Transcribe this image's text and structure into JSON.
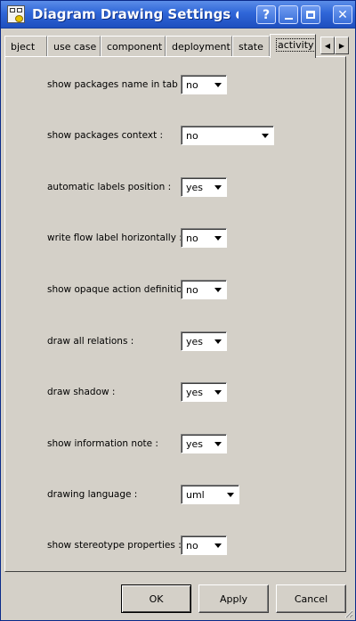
{
  "window": {
    "title": "Diagram Drawing Settings dialog",
    "buttons": {
      "help": "?",
      "close": "✕"
    }
  },
  "tabs": [
    {
      "label": "bject",
      "active": false
    },
    {
      "label": "use case",
      "active": false
    },
    {
      "label": "component",
      "active": false
    },
    {
      "label": "deployment",
      "active": false
    },
    {
      "label": "state",
      "active": false
    },
    {
      "label": "activity",
      "active": true
    }
  ],
  "settings": [
    {
      "label": "show packages name in tab :",
      "value": "no"
    },
    {
      "label": "show packages context :",
      "value": "no"
    },
    {
      "label": "automatic labels position :",
      "value": "yes"
    },
    {
      "label": "write flow label horizontally :",
      "value": "no"
    },
    {
      "label": "show opaque action definition :",
      "value": "no"
    },
    {
      "label": "draw all relations :",
      "value": "yes"
    },
    {
      "label": "draw shadow :",
      "value": "yes"
    },
    {
      "label": "show information note :",
      "value": "yes"
    },
    {
      "label": "drawing language :",
      "value": "uml"
    },
    {
      "label": "show stereotype properties :",
      "value": "no"
    }
  ],
  "footer": {
    "ok_label": "OK",
    "apply_label": "Apply",
    "cancel_label": "Cancel"
  },
  "colors": {
    "titlebar": "#2f66d8",
    "dialog_bg": "#d4d0c8"
  }
}
